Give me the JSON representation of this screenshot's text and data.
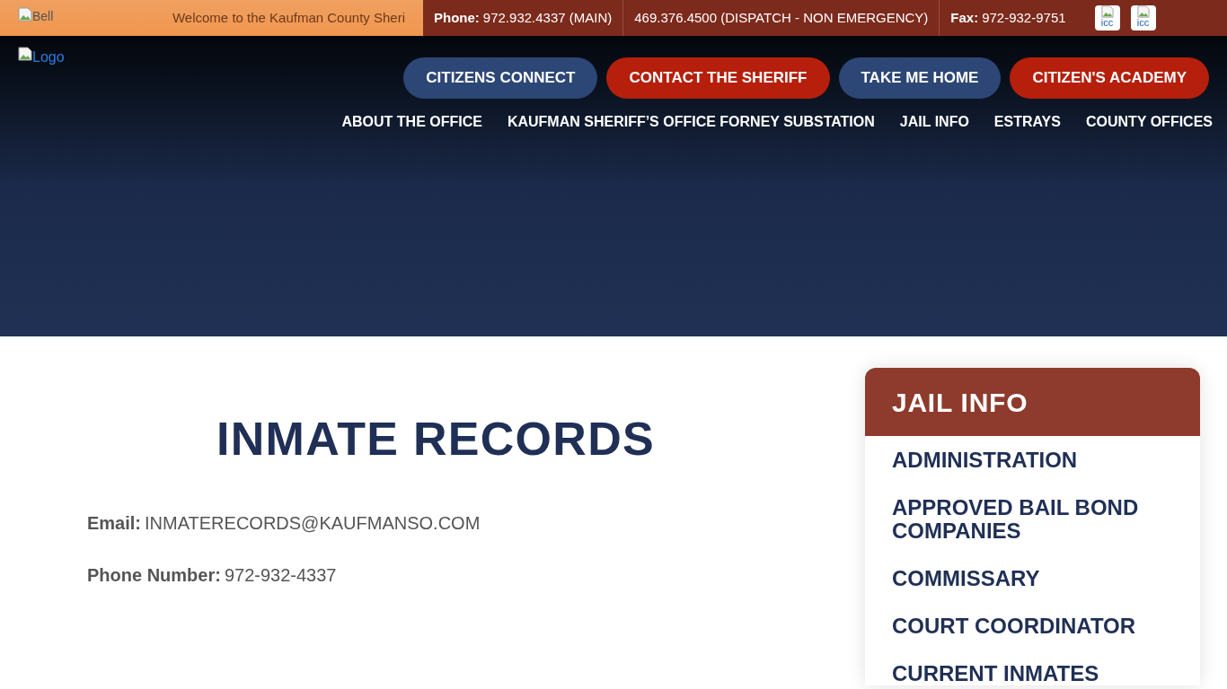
{
  "top_bar": {
    "bell_alt": "Bell",
    "welcome": "Welcome to the Kaufman County Sheri",
    "contacts": [
      {
        "label": "Phone:",
        "value": "972.932.4337 (MAIN)"
      },
      {
        "value": "469.376.4500 (DISPATCH - NON EMERGENCY)"
      },
      {
        "label": "Fax:",
        "value": "972-932-9751"
      }
    ],
    "social_alts": [
      "icc",
      "icc"
    ]
  },
  "header": {
    "logo_alt": "Logo",
    "buttons": [
      {
        "label": "CITIZENS CONNECT",
        "color": "#2c4675"
      },
      {
        "label": "CONTACT THE SHERIFF",
        "color": "#b51f0c"
      },
      {
        "label": "TAKE ME HOME",
        "color": "#2c4675"
      },
      {
        "label": "CITIZEN'S ACADEMY",
        "color": "#b51f0c"
      }
    ],
    "nav": [
      "ABOUT THE OFFICE",
      "KAUFMAN SHERIFF’S OFFICE FORNEY SUBSTATION",
      "JAIL INFO",
      "ESTRAYS",
      "COUNTY OFFICES"
    ]
  },
  "main": {
    "title": "INMATE RECORDS",
    "fields": [
      {
        "label": "Email:",
        "value": "INMATERECORDS@KAUFMANSO.COM"
      },
      {
        "label": "Phone Number:",
        "value": "972-932-4337"
      }
    ]
  },
  "sidebar": {
    "title": "JAIL INFO",
    "items": [
      "ADMINISTRATION",
      "APPROVED BAIL BOND COMPANIES",
      "COMMISSARY",
      "COURT COORDINATOR",
      "CURRENT INMATES"
    ]
  }
}
